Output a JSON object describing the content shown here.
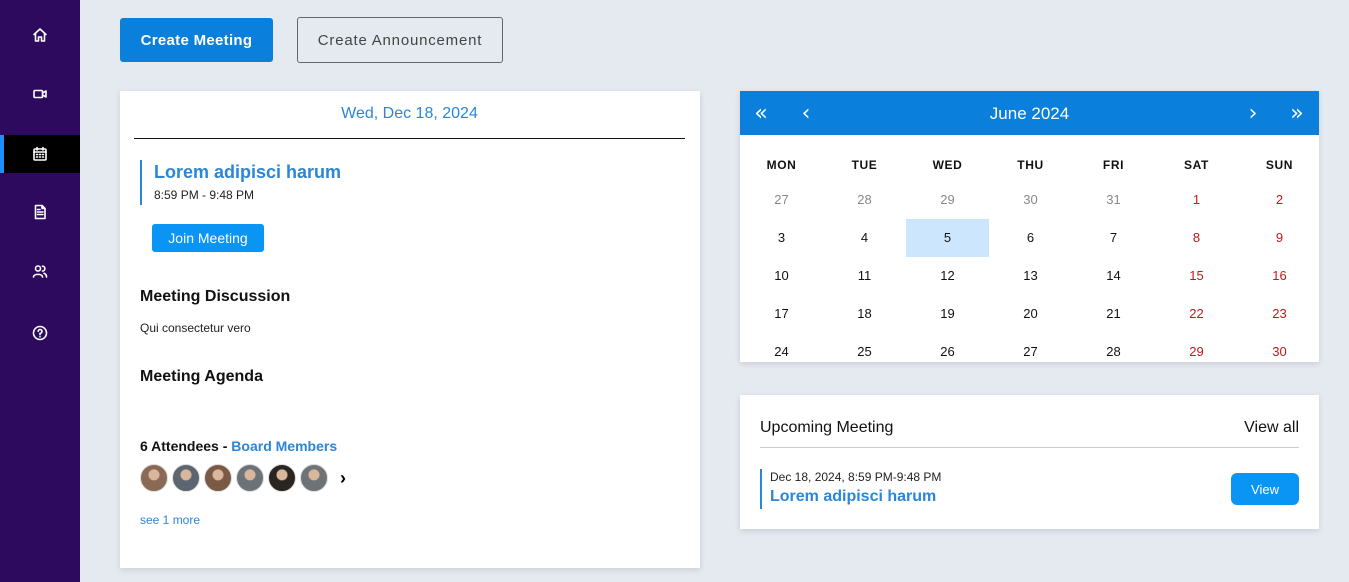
{
  "sidebar": {
    "items": [
      {
        "icon": "home-icon",
        "active": false
      },
      {
        "icon": "video-icon",
        "active": false
      },
      {
        "icon": "calendar-icon",
        "active": true
      },
      {
        "icon": "document-icon",
        "active": false
      },
      {
        "icon": "users-icon",
        "active": false
      },
      {
        "icon": "help-icon",
        "active": false
      }
    ]
  },
  "toolbar": {
    "create_meeting_label": "Create Meeting",
    "create_announcement_label": "Create Announcement"
  },
  "meeting_detail": {
    "date": "Wed, Dec 18, 2024",
    "title": "Lorem adipisci harum",
    "time": "8:59 PM - 9:48 PM",
    "join_label": "Join Meeting",
    "discussion_heading": "Meeting Discussion",
    "discussion_text": "Qui consectetur vero",
    "agenda_heading": "Meeting Agenda",
    "attendees_count": "6 Attendees",
    "attendees_separator": " - ",
    "attendees_group": "Board Members",
    "see_more": "see 1 more",
    "avatar_colors": [
      "#8a6a55",
      "#5d6670",
      "#7a5a44",
      "#6b7278",
      "#2b2522",
      "#6e7378"
    ]
  },
  "calendar": {
    "title": "June 2024",
    "prev_year": "«",
    "prev_month": "‹",
    "next_month": "›",
    "next_year": "»",
    "weekdays": [
      "MON",
      "TUE",
      "WED",
      "THU",
      "FRI",
      "SAT",
      "SUN"
    ],
    "weeks": [
      [
        "27",
        "28",
        "29",
        "30",
        "31",
        "1",
        "2"
      ],
      [
        "3",
        "4",
        "5",
        "6",
        "7",
        "8",
        "9"
      ],
      [
        "10",
        "11",
        "12",
        "13",
        "14",
        "15",
        "16"
      ],
      [
        "17",
        "18",
        "19",
        "20",
        "21",
        "22",
        "23"
      ],
      [
        "24",
        "25",
        "26",
        "27",
        "28",
        "29",
        "30"
      ]
    ],
    "muted_first_row_count": 5,
    "selected_day": "5",
    "weekend_color": "#c21818",
    "selected_color": "#cce7fd"
  },
  "upcoming": {
    "title": "Upcoming Meeting",
    "view_all": "View all",
    "items": [
      {
        "datetime": "Dec 18, 2024, 8:59 PM-9:48 PM",
        "name": "Lorem adipisci harum",
        "view_label": "View"
      }
    ]
  },
  "colors": {
    "sidebar": "#2e0a5e",
    "accent": "#0a7fdc",
    "link": "#2b86d8"
  }
}
